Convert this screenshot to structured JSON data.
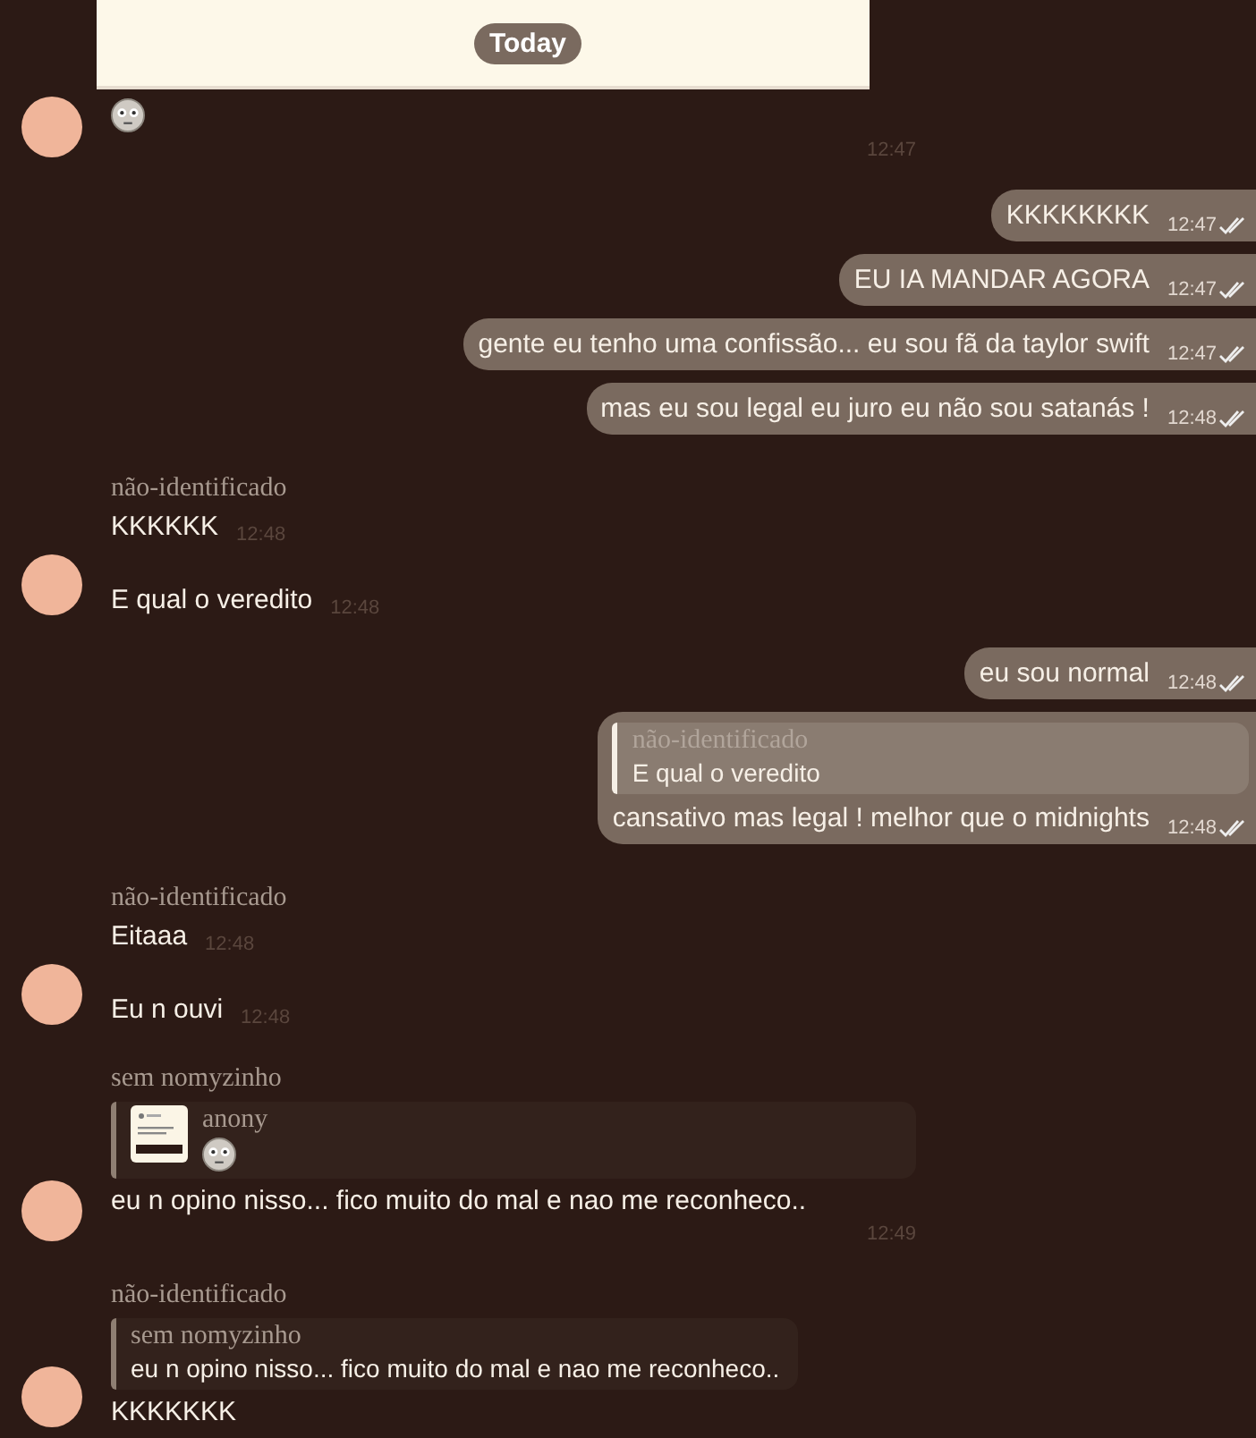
{
  "date_chip": "Today",
  "messages": [
    {
      "kind": "emoji",
      "avatar": true,
      "time": "12:47"
    },
    {
      "kind": "out",
      "text": "KKKKKKKK",
      "time": "12:47",
      "read": true
    },
    {
      "kind": "out",
      "text": "EU IA MANDAR AGORA",
      "time": "12:47",
      "read": true
    },
    {
      "kind": "out",
      "text": "gente eu tenho uma confissão... eu sou fã da taylor swift",
      "time": "12:47",
      "read": true
    },
    {
      "kind": "out",
      "text": "mas eu sou legal eu juro eu não sou satanás !",
      "time": "12:48",
      "read": true
    },
    {
      "kind": "in",
      "sender": "não-identificado",
      "text": "KKKKKK",
      "time": "12:48",
      "avatar": false
    },
    {
      "kind": "in",
      "text": "E qual o veredito",
      "time": "12:48",
      "avatar": true
    },
    {
      "kind": "out",
      "text": "eu sou normal",
      "time": "12:48",
      "read": true
    },
    {
      "kind": "out",
      "reply": {
        "sender": "não-identificado",
        "text": "E qual o veredito"
      },
      "text": "cansativo mas legal ! melhor que o midnights",
      "time": "12:48",
      "read": true
    },
    {
      "kind": "in",
      "sender": "não-identificado",
      "text": "Eitaaa",
      "time": "12:48",
      "avatar": false
    },
    {
      "kind": "in",
      "text": "Eu n ouvi",
      "time": "12:48",
      "avatar": true
    },
    {
      "kind": "in-wide",
      "sender": "sem nomyzinho",
      "reply": {
        "sender": "anony",
        "attachment": true,
        "emoji": true
      },
      "text": "eu n opino nisso... fico muito do mal e nao me reconheco..",
      "time": "12:49",
      "avatar": true
    },
    {
      "kind": "in",
      "sender": "não-identificado",
      "reply": {
        "sender": "sem nomyzinho",
        "text": "eu n opino nisso... fico muito do mal e nao me reconheco.."
      },
      "text": "KKKKKKK",
      "avatar": true
    }
  ]
}
